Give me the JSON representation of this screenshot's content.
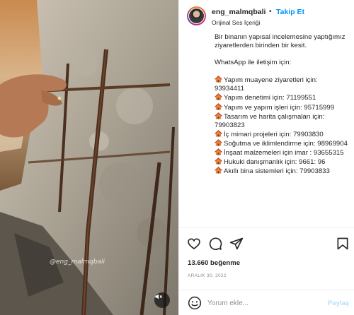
{
  "header": {
    "username": "eng_malmqbali",
    "separator": "•",
    "follow_label": "Takip Et",
    "audio_label": "Orijinal Ses İçeriği"
  },
  "caption": {
    "intro": "Bir binanın yapısal incelemesine yaptığımız ziyaretlerden birinden bir kesit.",
    "contact_heading": "WhatsApp ile iletişim için:",
    "lines": [
      "Yapım muayene ziyaretleri için: 93934411",
      "Yapım denetimi için: 71199551",
      "Yapım ve yapım işleri için: 95715999",
      "Tasarım ve harita çalışmaları için: 79903823",
      "İç mimari projeleri için: 79903830",
      "Soğutma ve iklimlendirme için: 98969904",
      "İnşaat malzemeleri için imar : 93655315",
      "Hukuki danışmanlık için: 9661: 96",
      "Akıllı bina sistemleri için: 79903833"
    ]
  },
  "media": {
    "watermark": "@eng_malmqbali"
  },
  "actions": {
    "like_icon": "heart-icon",
    "comment_icon": "comment-icon",
    "share_icon": "share-icon",
    "save_icon": "bookmark-icon"
  },
  "stats": {
    "likes": "13.660 beğenme",
    "date": "ARALIK 30, 2022"
  },
  "comment": {
    "placeholder": "Yorum ekle...",
    "post_label": "Paylaş"
  },
  "colors": {
    "accent": "#0095f6",
    "post_disabled": "#b2dffc",
    "muted": "#8e8e8e",
    "text": "#262626"
  }
}
